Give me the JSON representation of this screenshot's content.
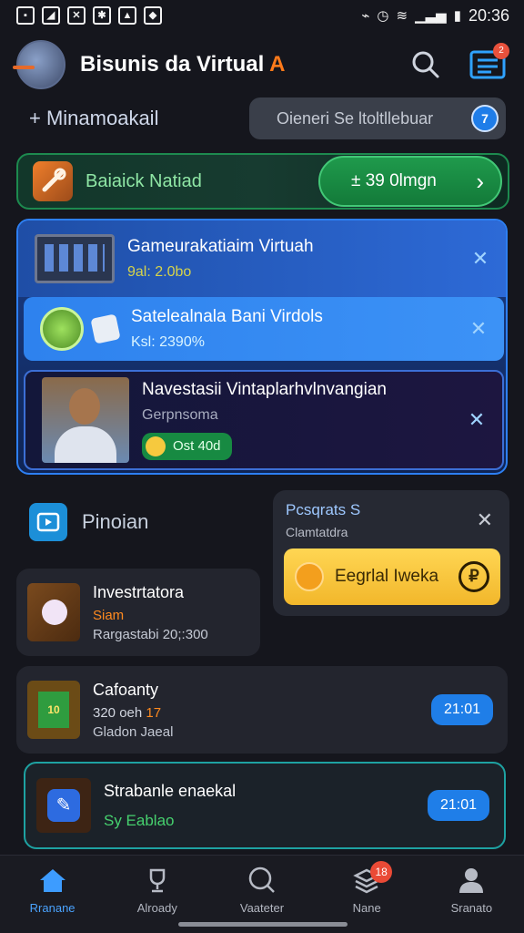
{
  "status_bar": {
    "left_icons": [
      "photo-icon",
      "image-icon",
      "block-icon",
      "bug-icon",
      "fire-icon",
      "puzzle-icon"
    ],
    "time": "20:36"
  },
  "header": {
    "title_main": "Bisunis  da Virtual ",
    "title_accent": "A",
    "notification_count": "2"
  },
  "subheader": {
    "label": "+ Minamoakail",
    "search_placeholder": "Oieneri Se ltoltllebuar",
    "search_button": "7"
  },
  "banner": {
    "title": "Baiaick Natiad",
    "cta": "± 39 0lmgn"
  },
  "list": [
    {
      "title": "Gameurakatiaim Virtuah",
      "subtitle": "9al: 2.0bo",
      "close": "✕"
    },
    {
      "title": "Satelealnala Bani Virdols",
      "subtitle": "Ksl: 2390%",
      "close": "✕"
    },
    {
      "title": "Navestasii Vintaplarhvlnvangian",
      "subtitle": "Gerpnsoma",
      "pill": "Ost 40d",
      "close": "✕"
    }
  ],
  "section": {
    "title": "Pinoian"
  },
  "popup": {
    "title": "Pcsqrats S",
    "subtitle": "Clamtatdra",
    "button_label": "Eegrlal Iweka",
    "close": "✕"
  },
  "cards": [
    {
      "title": "Investrtatora",
      "line2": "Siam",
      "line3": "Rargastabi 20;:300"
    },
    {
      "title": "Cafoanty",
      "line2_pre": "320 oeh ",
      "line2_hl": "17",
      "line3": "Gladon Jaeal",
      "badge": "21:01"
    },
    {
      "title": "Strabanle enaekal",
      "line2": "Sy Eablao",
      "badge": "21:01"
    }
  ],
  "nav": [
    {
      "label": "Rranane",
      "icon": "home-icon"
    },
    {
      "label": "Alroady",
      "icon": "trophy-icon"
    },
    {
      "label": "Vaateter",
      "icon": "search-icon"
    },
    {
      "label": "Nane",
      "icon": "stack-icon",
      "badge": "18"
    },
    {
      "label": "Sranato",
      "icon": "profile-icon"
    }
  ],
  "colors": {
    "background": "#15161d",
    "accent_orange": "#ff7a1a",
    "accent_blue": "#2d7ff2",
    "accent_green": "#1f9a4c",
    "popup_yellow": "#ffd653"
  }
}
